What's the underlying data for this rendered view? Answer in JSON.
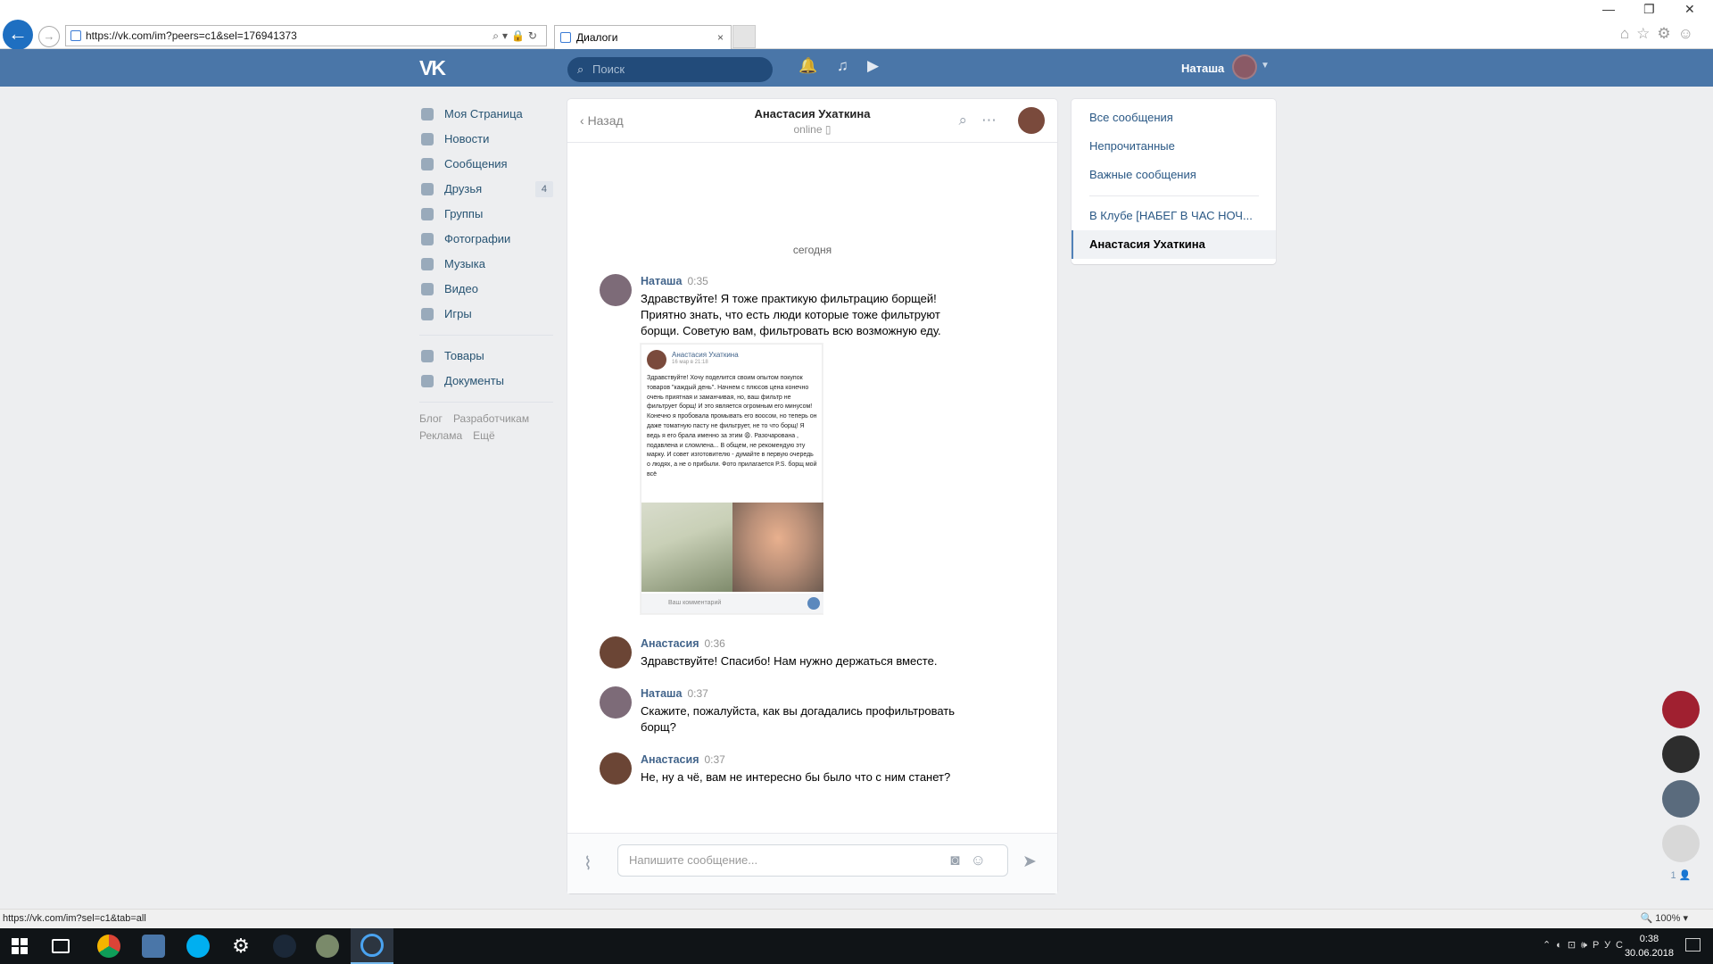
{
  "browser": {
    "url": "https://vk.com/im?peers=c1&sel=176941373",
    "tab_title": "Диалоги",
    "tab_close": "×",
    "status_url": "https://vk.com/im?sel=c1&tab=all",
    "zoom": "100%",
    "win_min": "—",
    "win_max": "❐",
    "win_close": "✕"
  },
  "header": {
    "logo": "VK",
    "search_placeholder": "Поиск",
    "user_name": "Наташа"
  },
  "sidebar": {
    "items": [
      {
        "label": "Моя Страница",
        "icon": "home-icon"
      },
      {
        "label": "Новости",
        "icon": "news-icon"
      },
      {
        "label": "Сообщения",
        "icon": "messages-icon"
      },
      {
        "label": "Друзья",
        "icon": "friends-icon",
        "badge": "4"
      },
      {
        "label": "Группы",
        "icon": "groups-icon"
      },
      {
        "label": "Фотографии",
        "icon": "photos-icon"
      },
      {
        "label": "Музыка",
        "icon": "music-icon"
      },
      {
        "label": "Видео",
        "icon": "video-icon"
      },
      {
        "label": "Игры",
        "icon": "games-icon"
      },
      {
        "label": "Товары",
        "icon": "market-icon"
      },
      {
        "label": "Документы",
        "icon": "docs-icon"
      }
    ],
    "footer": [
      "Блог",
      "Разработчикам",
      "Реклама",
      "Ещё"
    ]
  },
  "dialog": {
    "back_label": "Назад",
    "title": "Анастасия Ухаткина",
    "status": "online",
    "day_separator": "сегодня",
    "messages": [
      {
        "author": "Наташа",
        "time": "0:35",
        "text": "Здравствуйте! Я тоже практикую фильтрацию борщей! Приятно знать, что есть люди которые тоже фильтруют борщи. Советую вам, фильтровать всю возможную еду."
      },
      {
        "author": "Анастасия",
        "time": "0:36",
        "text": "Здравствуйте! Спасибо! Нам нужно держаться вместе."
      },
      {
        "author": "Наташа",
        "time": "0:37",
        "text": "Скажите, пожалуйста, как вы догадались профильтровать борщ?"
      },
      {
        "author": "Анастасия",
        "time": "0:37",
        "text": "Не, ну а чё, вам не интересно бы было что с ним станет?"
      }
    ],
    "attachment": {
      "author": "Анастасия Ухаткина",
      "date": "16 мар в 21:18",
      "text": "Здравствуйте! Хочу поделится своим опытом покупок товаров \"каждый день\". Начнем с плюсов цена конечно очень приятная и заманчивая, но, ваш фильтр не фильтрует борщ! И это является огромным его минусом! Конечно я пробовала промывать его воосом, но теперь он даже томатную пасту не фильтрует, не то что борщ! Я ведь я его брала именно за этим 😩. Разочарована , подавлена и сломлена... В общем, не рекомендую эту марку. И совет изготовителю - думайте в первую очередь о людях, а не о прибыли. Фото прилагается P.S. борщ мой всё",
      "comment_placeholder": "Ваш комментарий"
    },
    "input_placeholder": "Напишите сообщение..."
  },
  "right_menu": {
    "items": [
      "Все сообщения",
      "Непрочитанные",
      "Важные сообщения"
    ],
    "chats": [
      "В Клубе [НАБЕГ В ЧАС НОЧ...",
      "Анастасия Ухаткина"
    ]
  },
  "chat_bar": {
    "count": "1"
  },
  "taskbar": {
    "time": "0:38",
    "date": "30.06.2018",
    "lang": "РУС"
  },
  "colors": {
    "vk_blue": "#4a76a8",
    "link": "#2a5885",
    "taskbar": "#101417"
  }
}
